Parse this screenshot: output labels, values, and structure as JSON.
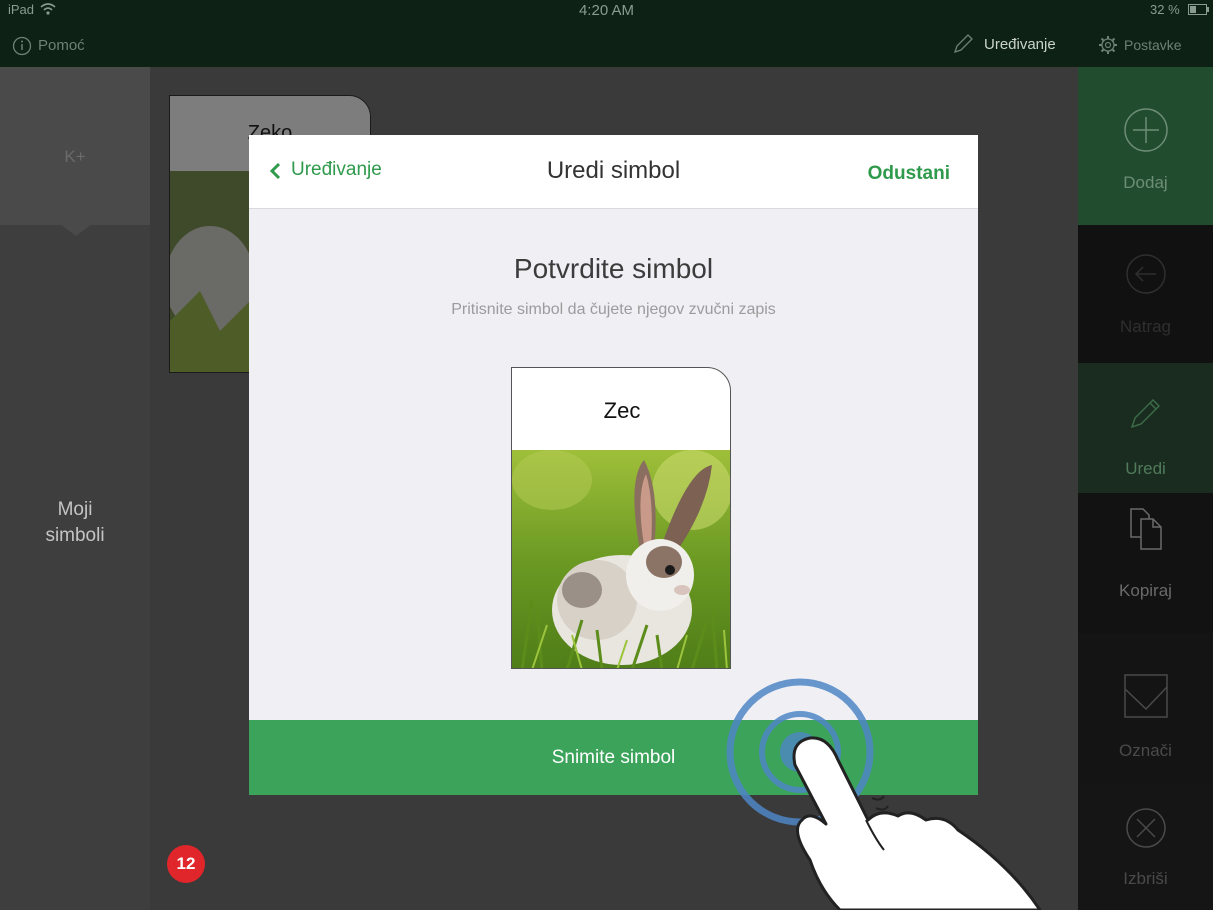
{
  "statusbar": {
    "device": "iPad",
    "time": "4:20 AM",
    "battery": "32 %",
    "help_label": "Pomoć",
    "edit_label": "Uređivanje",
    "settings_label": "Postavke"
  },
  "left_panel": {
    "tab_label": "K+",
    "section_label_line1": "Moji",
    "section_label_line2": "simboli"
  },
  "background_card": {
    "label": "Zeko"
  },
  "sidebar": {
    "items": [
      {
        "label": "Dodaj",
        "icon": "plus-circle-icon"
      },
      {
        "label": "Natrag",
        "icon": "back-arrow-circle-icon"
      },
      {
        "label": "Uredi",
        "icon": "pencil-icon"
      },
      {
        "label": "Kopiraj",
        "icon": "copy-icon"
      },
      {
        "label": "Označi",
        "icon": "checkbox-icon"
      },
      {
        "label": "Izbriši",
        "icon": "x-circle-icon"
      }
    ]
  },
  "modal": {
    "back_label": "Uređivanje",
    "title": "Uredi simbol",
    "cancel_label": "Odustani",
    "confirm_title": "Potvrdite simbol",
    "confirm_subtitle": "Pritisnite simbol da čujete njegov zvučni zapis",
    "card_label": "Zec",
    "record_button": "Snimite simbol"
  },
  "page_number": "12",
  "colors": {
    "accent_green": "#3ba35a",
    "link_green": "#2f9a4c",
    "badge_red": "#e0262a"
  }
}
